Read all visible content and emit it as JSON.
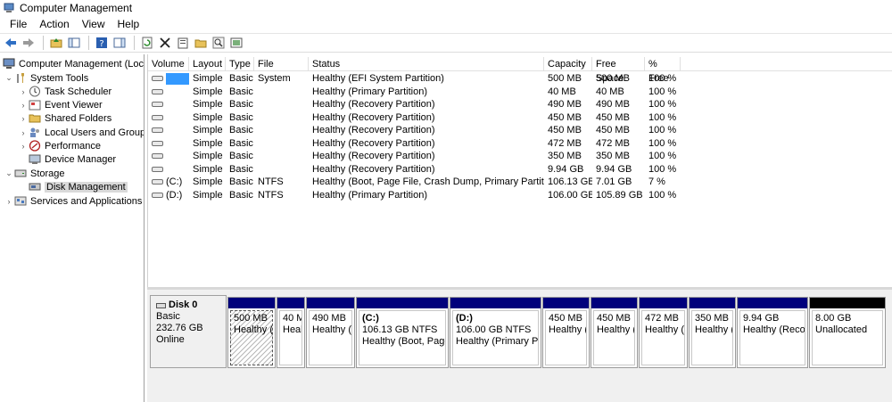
{
  "window": {
    "title": "Computer Management"
  },
  "menu": [
    "File",
    "Action",
    "View",
    "Help"
  ],
  "toolbar": [
    "back-icon",
    "forward-icon",
    "up-folder-icon",
    "show-hide-tree-icon",
    "help-icon",
    "show-hide-action-pane-icon",
    "refresh-icon",
    "delete-icon",
    "properties-icon",
    "open-icon",
    "search-icon",
    "export-icon"
  ],
  "tree": {
    "root": "Computer Management (Local",
    "system_tools": "System Tools",
    "task_scheduler": "Task Scheduler",
    "event_viewer": "Event Viewer",
    "shared_folders": "Shared Folders",
    "local_users": "Local Users and Groups",
    "performance": "Performance",
    "device_manager": "Device Manager",
    "storage": "Storage",
    "disk_management": "Disk Management",
    "services": "Services and Applications"
  },
  "columns": [
    "Volume",
    "Layout",
    "Type",
    "File System",
    "Status",
    "Capacity",
    "Free Space",
    "% Free"
  ],
  "volumes": [
    {
      "volume": "",
      "layout": "Simple",
      "type": "Basic",
      "fs": "",
      "status": "Healthy (EFI System Partition)",
      "capacity": "500 MB",
      "free": "500 MB",
      "pct": "100 %"
    },
    {
      "volume": "",
      "layout": "Simple",
      "type": "Basic",
      "fs": "",
      "status": "Healthy (Primary Partition)",
      "capacity": "40 MB",
      "free": "40 MB",
      "pct": "100 %"
    },
    {
      "volume": "",
      "layout": "Simple",
      "type": "Basic",
      "fs": "",
      "status": "Healthy (Recovery Partition)",
      "capacity": "490 MB",
      "free": "490 MB",
      "pct": "100 %"
    },
    {
      "volume": "",
      "layout": "Simple",
      "type": "Basic",
      "fs": "",
      "status": "Healthy (Recovery Partition)",
      "capacity": "450 MB",
      "free": "450 MB",
      "pct": "100 %"
    },
    {
      "volume": "",
      "layout": "Simple",
      "type": "Basic",
      "fs": "",
      "status": "Healthy (Recovery Partition)",
      "capacity": "450 MB",
      "free": "450 MB",
      "pct": "100 %"
    },
    {
      "volume": "",
      "layout": "Simple",
      "type": "Basic",
      "fs": "",
      "status": "Healthy (Recovery Partition)",
      "capacity": "472 MB",
      "free": "472 MB",
      "pct": "100 %"
    },
    {
      "volume": "",
      "layout": "Simple",
      "type": "Basic",
      "fs": "",
      "status": "Healthy (Recovery Partition)",
      "capacity": "350 MB",
      "free": "350 MB",
      "pct": "100 %"
    },
    {
      "volume": "",
      "layout": "Simple",
      "type": "Basic",
      "fs": "",
      "status": "Healthy (Recovery Partition)",
      "capacity": "9.94 GB",
      "free": "9.94 GB",
      "pct": "100 %"
    },
    {
      "volume": "(C:)",
      "layout": "Simple",
      "type": "Basic",
      "fs": "NTFS",
      "status": "Healthy (Boot, Page File, Crash Dump, Primary Partition)",
      "capacity": "106.13 GB",
      "free": "7.01 GB",
      "pct": "7 %"
    },
    {
      "volume": "(D:)",
      "layout": "Simple",
      "type": "Basic",
      "fs": "NTFS",
      "status": "Healthy (Primary Partition)",
      "capacity": "106.00 GB",
      "free": "105.89 GB",
      "pct": "100 %"
    }
  ],
  "disk": {
    "name": "Disk 0",
    "type": "Basic",
    "size": "232.76 GB",
    "state": "Online"
  },
  "partitions": [
    {
      "label": "",
      "size": "500 MB",
      "status": "Healthy ("
    },
    {
      "label": "",
      "size": "40 M",
      "status": "Heal"
    },
    {
      "label": "",
      "size": "490 MB",
      "status": "Healthy ("
    },
    {
      "label": "(C:)",
      "size": "106.13 GB NTFS",
      "status": "Healthy (Boot, Page"
    },
    {
      "label": "(D:)",
      "size": "106.00 GB NTFS",
      "status": "Healthy (Primary Pa"
    },
    {
      "label": "",
      "size": "450 MB",
      "status": "Healthy ("
    },
    {
      "label": "",
      "size": "450 MB",
      "status": "Healthy ("
    },
    {
      "label": "",
      "size": "472 MB",
      "status": "Healthy ("
    },
    {
      "label": "",
      "size": "350 MB",
      "status": "Healthy ("
    },
    {
      "label": "",
      "size": "9.94 GB",
      "status": "Healthy (Recov"
    },
    {
      "label": "",
      "size": "8.00 GB",
      "status": "Unallocated"
    }
  ]
}
